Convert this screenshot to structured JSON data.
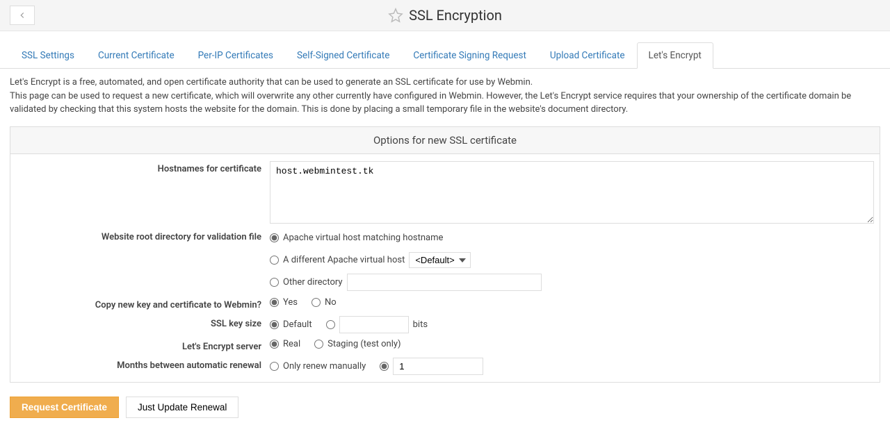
{
  "header": {
    "title": "SSL Encryption"
  },
  "tabs": [
    {
      "label": "SSL Settings",
      "active": false
    },
    {
      "label": "Current Certificate",
      "active": false
    },
    {
      "label": "Per-IP Certificates",
      "active": false
    },
    {
      "label": "Self-Signed Certificate",
      "active": false
    },
    {
      "label": "Certificate Signing Request",
      "active": false
    },
    {
      "label": "Upload Certificate",
      "active": false
    },
    {
      "label": "Let's Encrypt",
      "active": true
    }
  ],
  "desc": {
    "line1": "Let's Encrypt is a free, automated, and open certificate authority that can be used to generate an SSL certificate for use by Webmin.",
    "line2": "This page can be used to request a new certificate, which will overwrite any other currently have configured in Webmin. However, the Let's Encrypt service requires that your ownership of the certificate domain be validated by checking that this system hosts the website for the domain. This is done by placing a small temporary file in the website's document directory."
  },
  "panel": {
    "title": "Options for new SSL certificate",
    "fields": {
      "hostnames": {
        "label": "Hostnames for certificate",
        "value": "host.webmintest.tk"
      },
      "webroot": {
        "label": "Website root directory for validation file",
        "opt1": "Apache virtual host matching hostname",
        "opt2": "A different Apache virtual host",
        "opt2_select": "<Default>",
        "opt3": "Other directory",
        "opt3_value": ""
      },
      "copykey": {
        "label": "Copy new key and certificate to Webmin?",
        "yes": "Yes",
        "no": "No"
      },
      "keysize": {
        "label": "SSL key size",
        "default": "Default",
        "custom_value": "",
        "unit": "bits"
      },
      "server": {
        "label": "Let's Encrypt server",
        "real": "Real",
        "staging": "Staging (test only)"
      },
      "renewal": {
        "label": "Months between automatic renewal",
        "manual": "Only renew manually",
        "months_value": "1"
      }
    }
  },
  "buttons": {
    "request": "Request Certificate",
    "update": "Just Update Renewal"
  }
}
